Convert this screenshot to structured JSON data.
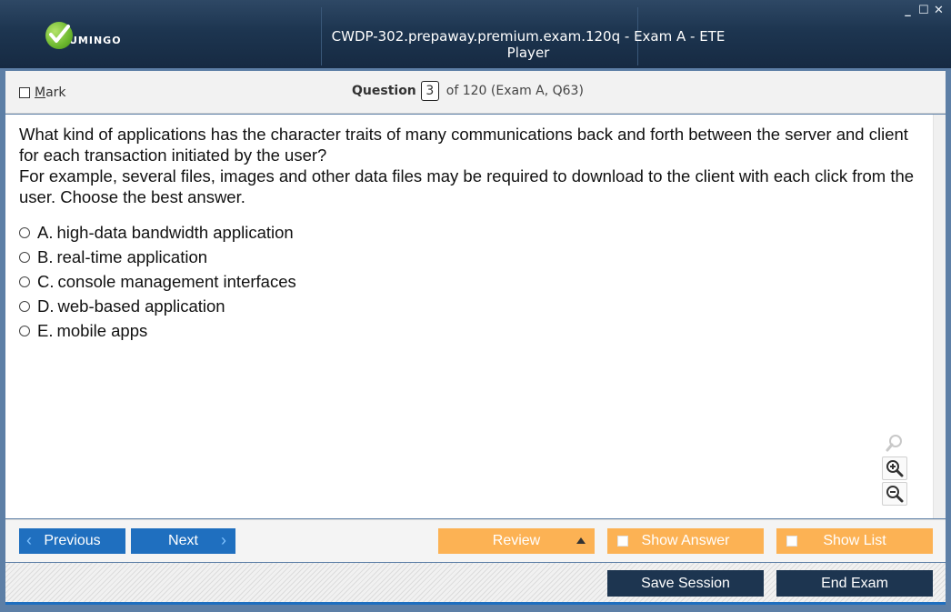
{
  "window": {
    "title": "CWDP-302.prepaway.premium.exam.120q - Exam A - ETE Player",
    "logo_text": "UMINGO",
    "controls": {
      "minimize": "_",
      "maximize": "☐",
      "close": "✕"
    }
  },
  "header": {
    "mark_label_underlined": "M",
    "mark_label_rest": "ark",
    "question_label": "Question",
    "question_number": "3",
    "question_of": "of 120 (Exam A, Q63)"
  },
  "question": {
    "line1": "What kind of applications has the character traits of many communications back and forth between the server and client for each transaction initiated by the user?",
    "line2": "For example, several files, images and other data files may be required to download to the client with each click from the user. Choose the best answer.",
    "answers": [
      {
        "letter": "A.",
        "text": "high-data bandwidth application"
      },
      {
        "letter": "B.",
        "text": "real-time application"
      },
      {
        "letter": "C.",
        "text": "console management interfaces"
      },
      {
        "letter": "D.",
        "text": "web-based application"
      },
      {
        "letter": "E.",
        "text": "mobile apps"
      }
    ]
  },
  "zoom": {
    "icons": [
      "zoom-reset-icon",
      "zoom-in-icon",
      "zoom-out-icon"
    ]
  },
  "nav": {
    "previous_label": "Previous",
    "previous_chevron": "‹",
    "next_label": "Next",
    "next_chevron": "›",
    "review_label": "Review",
    "show_answer_label": "Show Answer",
    "show_list_label": "Show List"
  },
  "bottom": {
    "save_session_label": "Save Session",
    "end_exam_label": "End Exam"
  },
  "colors": {
    "titlebar": "#1d3550",
    "primary_blue": "#1f6fbf",
    "orange": "#fcb254",
    "dark_button": "#1d3550"
  }
}
